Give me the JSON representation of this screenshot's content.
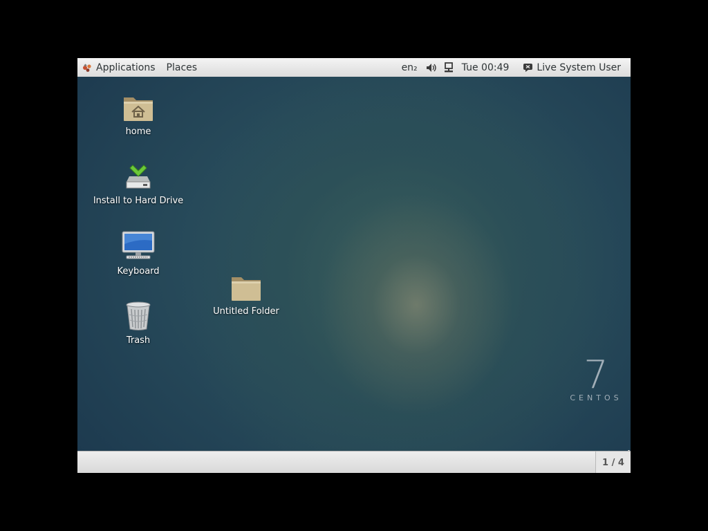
{
  "top_panel": {
    "applications_label": "Applications",
    "places_label": "Places",
    "keyboard_layout": "en₂",
    "clock": "Tue 00:49",
    "user_name": "Live System User",
    "icons": [
      "applications-icon",
      "volume-icon",
      "network-icon",
      "user-status-icon"
    ]
  },
  "desktop": {
    "icons": [
      {
        "label": "home",
        "icon": "home-folder-icon"
      },
      {
        "label": "Install to Hard Drive",
        "icon": "install-drive-icon"
      },
      {
        "label": "Keyboard",
        "icon": "computer-monitor-icon"
      },
      {
        "label": "Trash",
        "icon": "trash-icon"
      },
      {
        "label": "Untitled Folder",
        "icon": "folder-icon"
      }
    ],
    "watermark": {
      "number": "7",
      "word": "CENTOS"
    }
  },
  "bottom_panel": {
    "workspace": "1 / 4"
  },
  "colors": {
    "panel": "#dcdcdc",
    "desktop_base": "#274a5a",
    "folder": "#c9b88f",
    "install_check": "#6cc93a"
  }
}
